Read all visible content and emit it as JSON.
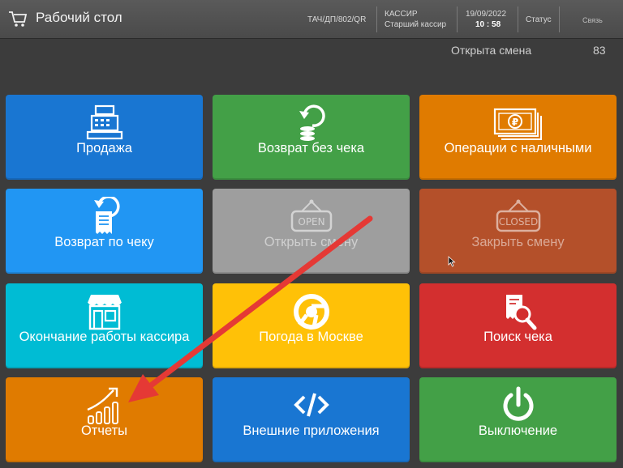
{
  "header": {
    "title": "Рабочий стол",
    "device": "ТАЧ/ДП/802/QR",
    "role": "КАССИР",
    "user": "Старший кассир",
    "date": "19/09/2022",
    "time": "10 : 58",
    "status": "Статус",
    "connection": "Связь"
  },
  "shift": {
    "status": "Открыта смена",
    "number": "83"
  },
  "tiles": [
    {
      "label": "Продажа",
      "color": "#1976d2",
      "icon": "cash-register-icon",
      "enabled": true
    },
    {
      "label": "Возврат без чека",
      "color": "#43a047",
      "icon": "coins-return-icon",
      "enabled": true
    },
    {
      "label": "Операции с наличными",
      "color": "#e07b00",
      "icon": "banknotes-icon",
      "enabled": true
    },
    {
      "label": "Возврат по чеку",
      "color": "#2196f3",
      "icon": "receipt-return-icon",
      "enabled": true
    },
    {
      "label": "Открыть смену",
      "color": "#9e9e9e",
      "icon": "open-sign-icon",
      "enabled": false,
      "sign": "OPEN"
    },
    {
      "label": "Закрыть смену",
      "color": "#b4502a",
      "icon": "closed-sign-icon",
      "enabled": false,
      "sign": "CLOSED"
    },
    {
      "label": "Окончание работы кассира",
      "color": "#00bcd4",
      "icon": "store-icon",
      "enabled": true
    },
    {
      "label": "Погода в Москве",
      "color": "#ffc107",
      "icon": "chrome-icon",
      "enabled": true
    },
    {
      "label": "Поиск чека",
      "color": "#d32f2f",
      "icon": "receipt-search-icon",
      "enabled": true
    },
    {
      "label": "Отчеты",
      "color": "#e07b00",
      "icon": "chart-growth-icon",
      "enabled": true
    },
    {
      "label": "Внешние приложения",
      "color": "#1976d2",
      "icon": "code-icon",
      "enabled": true
    },
    {
      "label": "Выключение",
      "color": "#43a047",
      "icon": "power-icon",
      "enabled": true
    }
  ],
  "colors": {
    "background": "#3c3c3c",
    "arrow": "#e53935"
  }
}
